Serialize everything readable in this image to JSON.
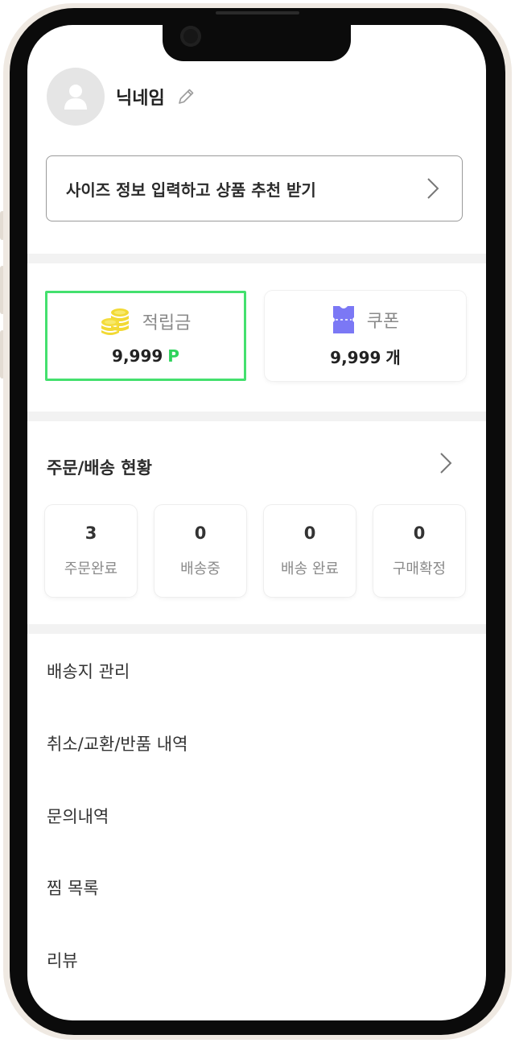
{
  "profile": {
    "nickname": "닉네임"
  },
  "banner": {
    "text": "사이즈 정보 입력하고 상품 추천 받기"
  },
  "rewards": {
    "points": {
      "label": "적립금",
      "value": "9,999",
      "unit": "P"
    },
    "coupon": {
      "label": "쿠폰",
      "value": "9,999",
      "unit": "개"
    }
  },
  "orders": {
    "title": "주문/배송 현황",
    "statuses": [
      {
        "count": "3",
        "label": "주문완료"
      },
      {
        "count": "0",
        "label": "배송중"
      },
      {
        "count": "0",
        "label": "배송 완료"
      },
      {
        "count": "0",
        "label": "구매확정"
      }
    ]
  },
  "menu": [
    {
      "label": "배송지 관리"
    },
    {
      "label": "취소/교환/반품 내역"
    },
    {
      "label": "문의내역"
    },
    {
      "label": "찜 목록"
    },
    {
      "label": "리뷰"
    }
  ],
  "colors": {
    "accent_green": "#2fd35c",
    "points_border": "#44e06e",
    "coupon_purple": "#7b78f5",
    "coin_yellow": "#f2d934"
  },
  "icons": [
    "user-icon",
    "pencil-icon",
    "chevron-right-icon",
    "coins-icon",
    "ticket-icon"
  ]
}
